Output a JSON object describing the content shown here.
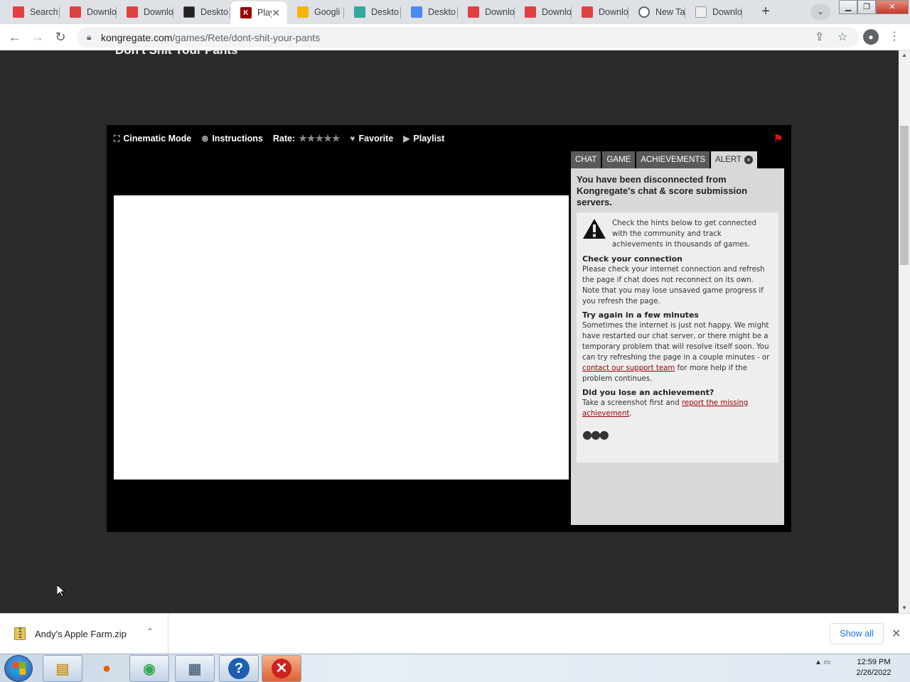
{
  "browser": {
    "tabs": [
      {
        "title": "Search",
        "icon": "pdf-icon"
      },
      {
        "title": "Downlo",
        "icon": "pdf-icon"
      },
      {
        "title": "Downlo",
        "icon": "pdf-icon"
      },
      {
        "title": "Deskto",
        "icon": "desktop-icon"
      },
      {
        "title": "Play",
        "icon": "kongregate-icon",
        "active": true
      },
      {
        "title": "Googli",
        "icon": "google-icon"
      },
      {
        "title": "Deskto",
        "icon": "desktop-teal-icon"
      },
      {
        "title": "Deskto",
        "icon": "desktop-blue-icon"
      },
      {
        "title": "Downlo",
        "icon": "pdf-icon"
      },
      {
        "title": "Downlo",
        "icon": "pdf-icon"
      },
      {
        "title": "Downlo",
        "icon": "pdf-icon"
      },
      {
        "title": "New Ta",
        "icon": "chrome-icon"
      },
      {
        "title": "Downlo",
        "icon": "doc-icon"
      }
    ],
    "url_host": "kongregate.com",
    "url_path": "/games/Rete/dont-shit-your-pants"
  },
  "page": {
    "game_title": "Don't Shit Your Pants",
    "gamebar": {
      "cinematic": "Cinematic Mode",
      "instructions": "Instructions",
      "rate": "Rate:",
      "stars": "★★★★★",
      "favorite": "Favorite",
      "playlist": "Playlist"
    },
    "chat_tabs": {
      "chat": "CHAT",
      "game": "GAME",
      "achievements": "ACHIEVEMENTS",
      "alert": "ALERT"
    },
    "alert": {
      "heading": "You have been disconnected from Kongregate's chat & score submission servers.",
      "intro": "Check the hints below to get connected with the community and track achievements in thousands of games.",
      "s1_title": "Check your connection",
      "s1_body": "Please check your internet connection and refresh the page if chat does not reconnect on its own. Note that you may lose unsaved game progress if you refresh the page.",
      "s2_title": "Try again in a few minutes",
      "s2_body": "Sometimes the internet is just not happy. We might have restarted our chat server, or there might be a temporary problem that will resolve itself soon. You can try refreshing the page in a couple minutes - or",
      "s2_link": "contact our support team",
      "s2_tail": "for more help if the problem continues.",
      "s3_title": "Did you lose an achievement?",
      "s3_body": "Take a screenshot first and",
      "s3_link": "report the missing achievement",
      "s3_tail": ".",
      "dots": "●●●"
    }
  },
  "downloads": {
    "file": "Andy's Apple Farm.zip",
    "show_all": "Show all"
  },
  "taskbar": {
    "time": "12:59 PM",
    "date": "2/26/2022"
  }
}
